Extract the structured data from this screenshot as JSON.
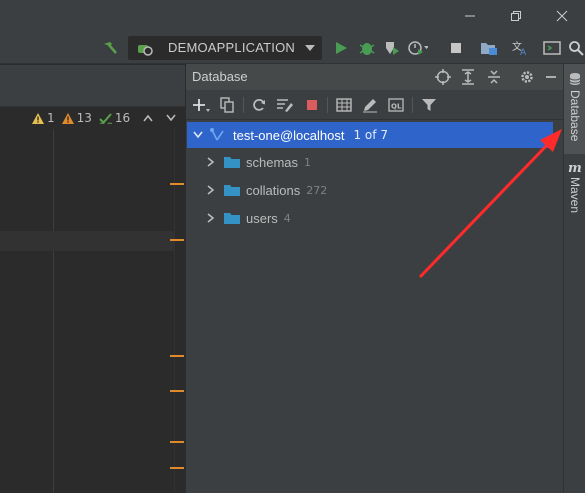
{
  "window": {
    "minimize_icon": "minimize-icon",
    "maximize_icon": "restore-icon",
    "close_icon": "close-icon"
  },
  "toolbar": {
    "run_config_label": "DEMOAPPLICATION",
    "icons": [
      "hammer-icon",
      "run-config-icon",
      "dropdown-arrow-icon",
      "run-icon",
      "debug-icon",
      "coverage-icon",
      "profile-icon",
      "stop-icon",
      "project-structure-icon",
      "translate-icon",
      "terminal-icon",
      "search-icon"
    ]
  },
  "editor": {
    "inspections": {
      "warnings": "1",
      "weak_warnings": "13",
      "typos": "16"
    },
    "marks_color": "#e08a2c"
  },
  "database_panel": {
    "title": "Database",
    "root": {
      "label": "test-one@localhost",
      "badge": "1 of 7"
    },
    "children": [
      {
        "label": "schemas",
        "count": "1"
      },
      {
        "label": "collations",
        "count": "272"
      },
      {
        "label": "users",
        "count": "4"
      }
    ],
    "selection_color": "#2f65ca"
  },
  "right_strip": {
    "database_label": "Database",
    "maven_label": "Maven"
  },
  "annotation": {
    "arrow_color": "#ff2a2a"
  }
}
